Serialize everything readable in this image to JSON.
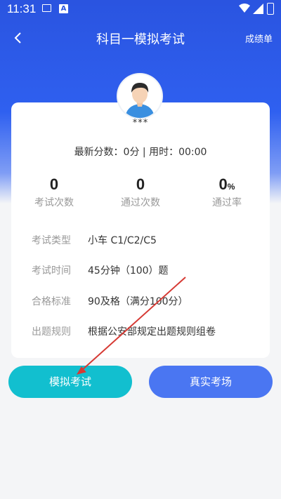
{
  "status_bar": {
    "time": "11:31",
    "icons": [
      "image-icon",
      "a-notification-icon",
      "wifi-icon",
      "signal-icon",
      "battery-icon"
    ]
  },
  "header": {
    "title": "科目一模拟考试",
    "right_link": "成绩单"
  },
  "profile": {
    "username": "***"
  },
  "summary": {
    "latest": "最新分数：0分 | 用时：00:00"
  },
  "stats": [
    {
      "value": "0",
      "unit": "",
      "label": "考试次数"
    },
    {
      "value": "0",
      "unit": "",
      "label": "通过次数"
    },
    {
      "value": "0",
      "unit": "%",
      "label": "通过率"
    }
  ],
  "info": [
    {
      "label": "考试类型",
      "value": "小车 C1/C2/C5"
    },
    {
      "label": "考试时间",
      "value": "45分钟（100）题"
    },
    {
      "label": "合格标准",
      "value": "90及格（满分100分）"
    },
    {
      "label": "出题规则",
      "value": "根据公安部规定出题规则组卷"
    }
  ],
  "buttons": {
    "mock": "模拟考试",
    "real": "真实考场"
  },
  "colors": {
    "header_blue": "#2f60f0",
    "mock_button": "#12bfcf",
    "real_button": "#4a76f2",
    "annotation_arrow": "#d63a34"
  }
}
